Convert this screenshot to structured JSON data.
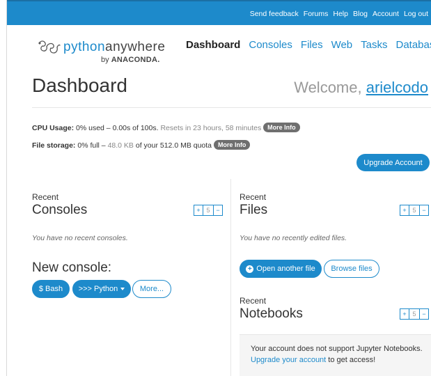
{
  "topbar": {
    "links": [
      "Send feedback",
      "Forums",
      "Help",
      "Blog",
      "Account",
      "Log out"
    ]
  },
  "brand": {
    "word_part1": "python",
    "word_part2": "anywhere",
    "by_text": "by",
    "by_company": "ANACONDA."
  },
  "nav": {
    "items": [
      "Dashboard",
      "Consoles",
      "Files",
      "Web",
      "Tasks",
      "Databases"
    ],
    "active": "Dashboard"
  },
  "page": {
    "title": "Dashboard",
    "welcome_prefix": "Welcome, ",
    "username": "arielcodo"
  },
  "usage": {
    "cpu_label": "CPU Usage:",
    "cpu_value": "0% used – 0.00s of 100s.",
    "cpu_reset": "Resets in 23 hours, 58 minutes",
    "file_label": "File storage:",
    "file_value_prefix": "0% full –",
    "file_value_amount": "48.0 KB",
    "file_value_suffix": "of your 512.0 MB quota",
    "more_info": "More Info"
  },
  "upgrade_button": "Upgrade Account",
  "consoles": {
    "recent": "Recent",
    "title": "Consoles",
    "counter": {
      "plus": "+",
      "value": "5",
      "minus": "−"
    },
    "empty": "You have no recent consoles.",
    "new_console_title": "New console:",
    "buttons": {
      "bash": "$ Bash",
      "python": ">>> Python",
      "more": "More..."
    }
  },
  "files": {
    "recent": "Recent",
    "title": "Files",
    "counter": {
      "plus": "+",
      "value": "5",
      "minus": "−"
    },
    "empty": "You have no recently edited files.",
    "open_button": "Open another file",
    "browse_button": "Browse files"
  },
  "notebooks": {
    "recent": "Recent",
    "title": "Notebooks",
    "counter": {
      "plus": "+",
      "value": "5",
      "minus": "−"
    },
    "notice_prefix": "Your account does not support Jupyter Notebooks.",
    "notice_link": "Upgrade your account",
    "notice_suffix": "to get access!"
  },
  "colors": {
    "brand_blue": "#1d8acb",
    "pill_gray": "#6f6f6f",
    "notice_bg": "#f5f5f5"
  }
}
